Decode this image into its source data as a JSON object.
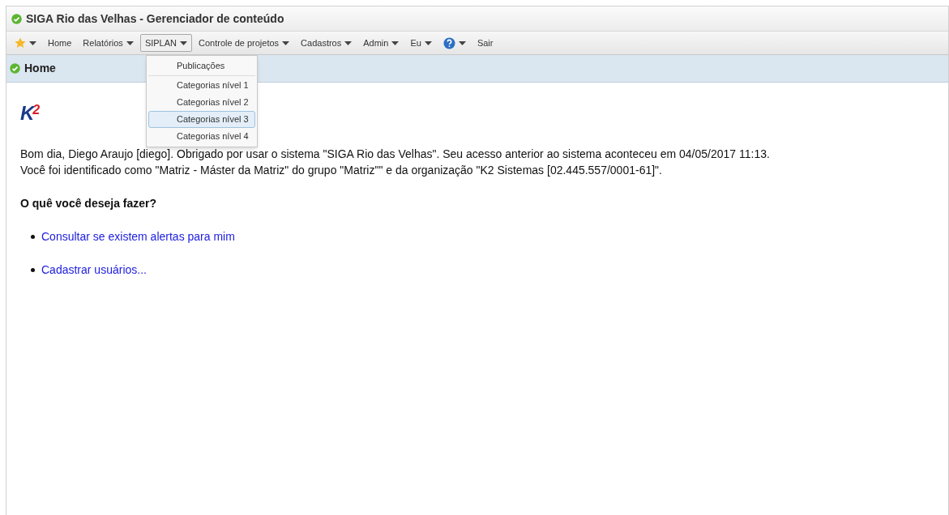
{
  "window": {
    "title": "SIGA Rio das Velhas - Gerenciador de conteúdo"
  },
  "menu": [
    {
      "kind": "star",
      "dropdown": true,
      "open": false
    },
    {
      "kind": "text",
      "label": "Home",
      "dropdown": false,
      "open": false
    },
    {
      "kind": "text",
      "label": "Relatórios",
      "dropdown": true,
      "open": false
    },
    {
      "kind": "text",
      "label": "SIPLAN",
      "dropdown": true,
      "open": true
    },
    {
      "kind": "text",
      "label": "Controle de projetos",
      "dropdown": true,
      "open": false
    },
    {
      "kind": "text",
      "label": "Cadastros",
      "dropdown": true,
      "open": false
    },
    {
      "kind": "text",
      "label": "Admin",
      "dropdown": true,
      "open": false
    },
    {
      "kind": "text",
      "label": "Eu",
      "dropdown": true,
      "open": false
    },
    {
      "kind": "help",
      "dropdown": true,
      "open": false
    },
    {
      "kind": "text",
      "label": "Sair",
      "dropdown": false,
      "open": false
    }
  ],
  "dropdown": [
    {
      "label": "Publicações",
      "selected": false,
      "separator_after": true
    },
    {
      "label": "Categorias nível 1",
      "selected": false,
      "separator_after": false
    },
    {
      "label": "Categorias nível 2",
      "selected": false,
      "separator_after": false
    },
    {
      "label": "Categorias nível 3",
      "selected": true,
      "separator_after": false
    },
    {
      "label": "Categorias nível 4",
      "selected": false,
      "separator_after": false
    }
  ],
  "panel": {
    "title": "Home"
  },
  "logo": {
    "main": "K",
    "sup": "2"
  },
  "greeting": [
    "Bom dia, Diego Araujo [diego]. Obrigado por usar o sistema \"SIGA Rio das Velhas\". Seu acesso anterior ao sistema aconteceu em 04/05/2017 11:13.",
    "Você foi identificado como \"Matriz - Máster da Matriz\" do grupo \"Matriz\"\" e da organização \"K2 Sistemas [02.445.557/0001-61]\"."
  ],
  "question": "O quê você deseja fazer?",
  "links": [
    "Consultar se existem alertas para mim",
    "Cadastrar usuários..."
  ]
}
